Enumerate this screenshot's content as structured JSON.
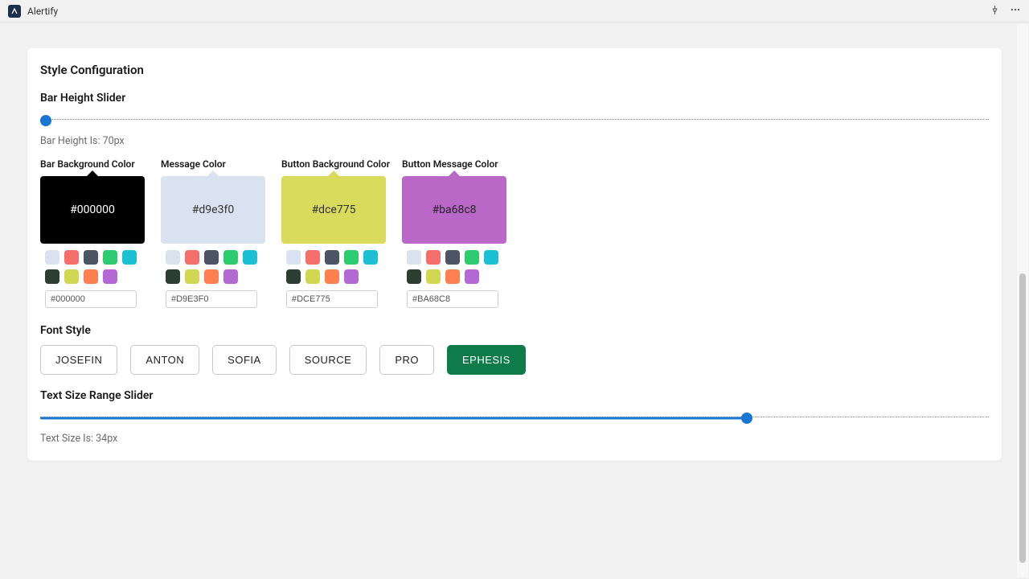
{
  "app": {
    "title": "Alertify"
  },
  "card": {
    "title": "Style Configuration"
  },
  "bar_slider": {
    "label": "Bar Height Slider",
    "readout": "Bar Height Is: 70px",
    "fill_percent": 0,
    "thumb_percent": 0.6
  },
  "colors": {
    "swatch_palette": [
      "#d9e3f0",
      "#f46e6a",
      "#4b5563",
      "#2ecc71",
      "#1abc9c",
      "#2c3e50",
      "#d0d852",
      "#ff7f50",
      "#b368d4"
    ],
    "groups": [
      {
        "label": "Bar Background Color",
        "value": "#000000",
        "input": "#000000",
        "preview_bg": "#000000",
        "preview_text": "#ffffff"
      },
      {
        "label": "Message Color",
        "value": "#d9e3f0",
        "input": "#D9E3F0",
        "preview_bg": "#d9e3f0",
        "preview_text": "#333333"
      },
      {
        "label": "Button Background Color",
        "value": "#dce775",
        "input": "#DCE775",
        "preview_bg": "#d9db5d",
        "preview_text": "#333333"
      },
      {
        "label": "Button Message Color",
        "value": "#ba68c8",
        "input": "#BA68C8",
        "preview_bg": "#ba68c8",
        "preview_text": "#222222"
      }
    ]
  },
  "font": {
    "label": "Font Style",
    "options": [
      "JOSEFIN",
      "ANTON",
      "SOFIA",
      "SOURCE",
      "PRO",
      "EPHESIS"
    ],
    "active": "EPHESIS"
  },
  "text_slider": {
    "label": "Text Size Range Slider",
    "readout": "Text Size Is: 34px",
    "fill_percent": 74.5,
    "thumb_percent": 74.5
  }
}
